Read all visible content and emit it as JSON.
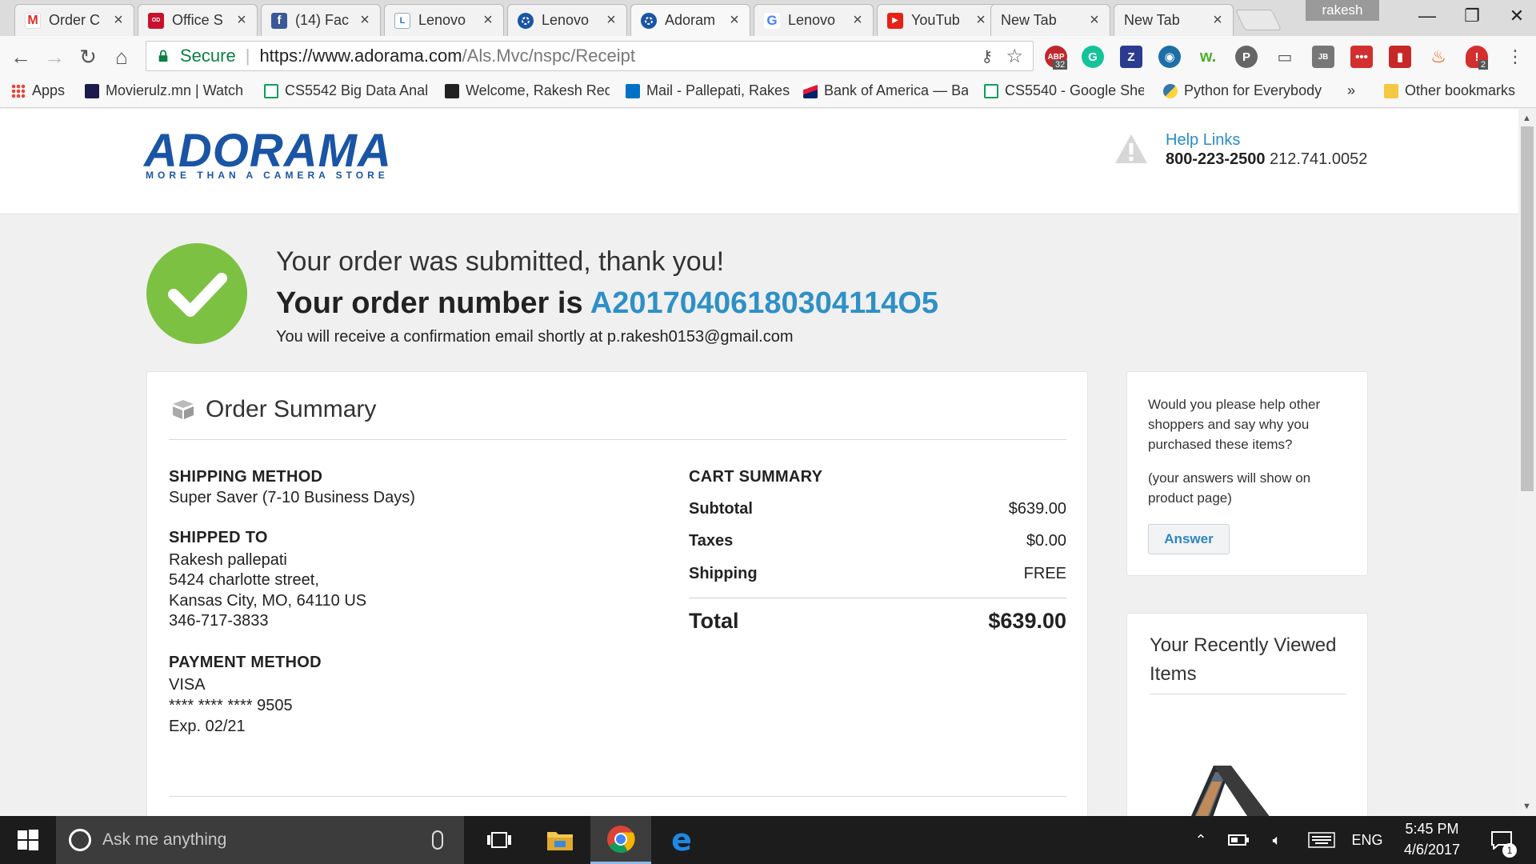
{
  "browser": {
    "tabs": [
      {
        "title": "Order C",
        "icon": "gmail-icon"
      },
      {
        "title": "Office S",
        "icon": "office-depot-icon"
      },
      {
        "title": "(14) Fac",
        "icon": "facebook-icon"
      },
      {
        "title": "Lenovo",
        "icon": "lenovo-icon"
      },
      {
        "title": "Lenovo",
        "icon": "adorama-icon"
      },
      {
        "title": "Adoram",
        "icon": "adorama-icon"
      },
      {
        "title": "Lenovo",
        "icon": "google-icon"
      },
      {
        "title": "YouTub",
        "icon": "youtube-icon"
      },
      {
        "title": "New Tab",
        "icon": "none"
      },
      {
        "title": "New Tab",
        "icon": "none"
      }
    ],
    "profile_name": "rakesh",
    "address": {
      "secure_label": "Secure",
      "url_host": "https://www.adorama.com",
      "url_path": "/Als.Mvc/nspc/Receipt"
    },
    "extensions": {
      "adblock_count": "32",
      "lastpass_count": "2"
    },
    "bookmarks": [
      "Apps",
      "Movierulz.mn | Watch",
      "CS5542 Big Data Anal",
      "Welcome, Rakesh Red",
      "Mail - Pallepati, Rakes",
      "Bank of America — Ba",
      "CS5540 - Google Shee",
      "Python for Everybody",
      "»",
      "Other bookmarks"
    ]
  },
  "header": {
    "logo_text": "ADORAMA",
    "logo_tagline": "MORE THAN A CAMERA STORE",
    "help_links": "Help Links",
    "phone_primary": "800-223-2500",
    "phone_secondary": "212.741.0052"
  },
  "confirmation": {
    "message": "Your order was submitted, thank you!",
    "order_number_prefix": "Your order number is",
    "order_number": "A20170406180304114O5",
    "email_line": "You will receive a confirmation email shortly at p.rakesh0153@gmail.com"
  },
  "summary": {
    "title": "Order Summary",
    "shipping_method_h": "SHIPPING METHOD",
    "shipping_method": "Super Saver (7-10 Business Days)",
    "shipped_to_h": "SHIPPED TO",
    "shipped_to": [
      "Rakesh pallepati",
      "5424 charlotte street,",
      "Kansas City, MO, 64110 US",
      "346-717-3833"
    ],
    "payment_method_h": "PAYMENT METHOD",
    "payment": [
      "VISA",
      "**** **** **** 9505",
      "Exp. 02/21"
    ],
    "cart_h": "CART SUMMARY",
    "cart": [
      {
        "label": "Subtotal",
        "value": "$639.00"
      },
      {
        "label": "Taxes",
        "value": "$0.00"
      },
      {
        "label": "Shipping",
        "value": "FREE"
      }
    ],
    "total_label": "Total",
    "total_value": "$639.00"
  },
  "feedback": {
    "question": "Would you please help other shoppers and say why you purchased these items?",
    "note": "(your answers will show on product page)",
    "answer_label": "Answer"
  },
  "recent": {
    "title": "Your Recently Viewed Items"
  },
  "taskbar": {
    "search_placeholder": "Ask me anything",
    "language": "ENG",
    "time": "5:45 PM",
    "date": "4/6/2017",
    "notifications": "1"
  },
  "colors": {
    "brand": "#1a55a5",
    "accent_link": "#2e90c6",
    "success": "#7dc142",
    "secure": "#0b8043"
  }
}
